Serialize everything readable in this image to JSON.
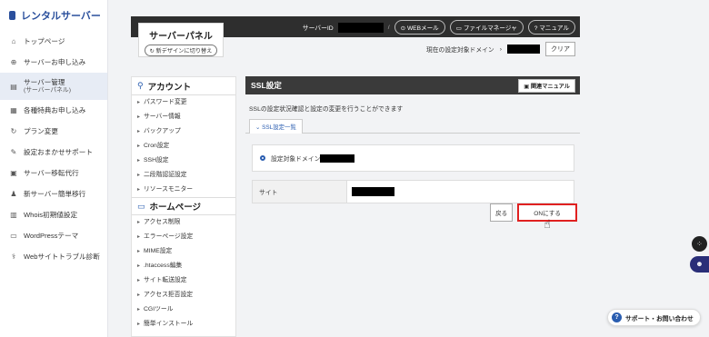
{
  "brand": {
    "name": "レンタルサーバー"
  },
  "global_nav": [
    {
      "icon": "home-icon",
      "glyph": "⌂",
      "label": "トップページ"
    },
    {
      "icon": "plus-circle-icon",
      "glyph": "⊕",
      "label": "サーバーお申し込み"
    },
    {
      "icon": "server-icon",
      "glyph": "▤",
      "label": "サーバー管理",
      "sub": "(サーバーパネル)",
      "active": true
    },
    {
      "icon": "gift-icon",
      "glyph": "▦",
      "label": "各種特典お申し込み"
    },
    {
      "icon": "refresh-icon",
      "glyph": "↻",
      "label": "プラン変更"
    },
    {
      "icon": "wrench-icon",
      "glyph": "✎",
      "label": "設定おまかせサポート"
    },
    {
      "icon": "transfer-icon",
      "glyph": "▣",
      "label": "サーバー移転代行"
    },
    {
      "icon": "user-move-icon",
      "glyph": "♟",
      "label": "新サーバー簡単移行"
    },
    {
      "icon": "whois-icon",
      "glyph": "▥",
      "label": "Whois初期値設定"
    },
    {
      "icon": "window-icon",
      "glyph": "▭",
      "label": "WordPressテーマ"
    },
    {
      "icon": "stethoscope-icon",
      "glyph": "⚕",
      "label": "Webサイトトラブル診断"
    }
  ],
  "panel": {
    "title": "サーバーパネル",
    "switch_label": "新デザインに切り替え",
    "server_id_label": "サーバーID",
    "slash": "/",
    "webmail_label": "WEBメール",
    "file_manager_label": "ファイルマネージャ",
    "manual_label": "マニュアル",
    "current_domain_label": "現在の設定対象ドメイン",
    "domain_sep": "›",
    "clear_label": "クリア"
  },
  "section_menu": {
    "account_title": "アカウント",
    "account_items": [
      "パスワード変更",
      "サーバー情報",
      "バックアップ",
      "Cron設定",
      "SSH設定",
      "二段階認証設定",
      "リソースモニター"
    ],
    "homepage_title": "ホームページ",
    "homepage_items": [
      "アクセス制限",
      "エラーページ設定",
      "MIME設定",
      ".htaccess編集",
      "サイト転送設定",
      "アクセス拒否設定",
      "CGIツール",
      "簡単インストール"
    ]
  },
  "main": {
    "title": "SSL設定",
    "manual_button": "関連マニュアル",
    "description": "SSLの設定状況確認と設定の変更を行うことができます",
    "tab_label": "SSL設定一覧",
    "domain_label": "設定対象ドメイン",
    "site_label": "サイト",
    "back_button": "戻る",
    "on_button": "ONにする"
  },
  "floating": {
    "support_label": "サポート・お問い合わせ",
    "support_q": "?"
  }
}
